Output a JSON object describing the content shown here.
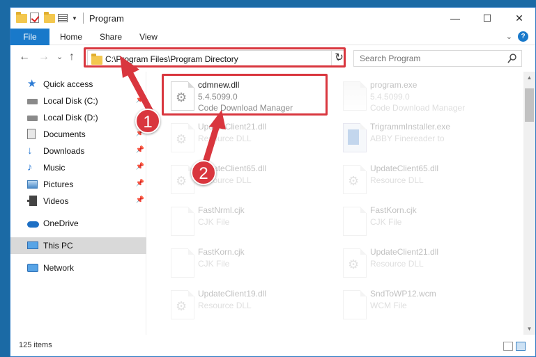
{
  "titlebar": {
    "title": "Program",
    "controls": {
      "minimize": "—",
      "maximize": "☐",
      "close": "✕"
    }
  },
  "ribbon": {
    "tabs": [
      "File",
      "Home",
      "Share",
      "View"
    ],
    "expand_icon": "chevron-down-icon",
    "help_label": "?"
  },
  "navigation": {
    "back": "←",
    "forward": "→",
    "recent": "⌄",
    "up": "↑",
    "address": "C:\\Program Files\\Program Directory",
    "refresh": "↻",
    "search_placeholder": "Search Program"
  },
  "sidebar": {
    "items": [
      {
        "label": "Quick access",
        "icon": "star-icon"
      },
      {
        "label": "Local Disk (C:)",
        "icon": "disk-icon",
        "pinned": true
      },
      {
        "label": "Local Disk (D:)",
        "icon": "disk-icon",
        "pinned": true
      },
      {
        "label": "Documents",
        "icon": "documents-icon",
        "pinned": true
      },
      {
        "label": "Downloads",
        "icon": "downloads-icon",
        "pinned": true
      },
      {
        "label": "Music",
        "icon": "music-icon",
        "pinned": true
      },
      {
        "label": "Pictures",
        "icon": "pictures-icon",
        "pinned": true
      },
      {
        "label": "Videos",
        "icon": "videos-icon",
        "pinned": true
      },
      {
        "label": "OneDrive",
        "icon": "onedrive-icon"
      },
      {
        "label": "This PC",
        "icon": "pc-icon",
        "selected": true
      },
      {
        "label": "Network",
        "icon": "network-icon"
      }
    ]
  },
  "files": [
    {
      "name": "cdmnew.dll",
      "line1": "5.4.5099.0",
      "line2": "Code Download Manager",
      "icon": "dll-file-icon",
      "highlighted": true
    },
    {
      "name": "program.exe",
      "line1": "5.4.5099.0",
      "line2": "Code Download Manager",
      "icon": "exe-file-icon"
    },
    {
      "name": "UpdateClient21.dll",
      "line1": "Resource DLL",
      "line2": "",
      "icon": "dll-file-icon"
    },
    {
      "name": "TrigrammInstaller.exe",
      "line1": "ABBY Finereader to",
      "line2": "",
      "icon": "installer-file-icon"
    },
    {
      "name": "UpdateClient65.dll",
      "line1": "Resource DLL",
      "line2": "",
      "icon": "dll-file-icon"
    },
    {
      "name": "UpdateClient65.dll",
      "line1": "Resource DLL",
      "line2": "",
      "icon": "dll-file-icon"
    },
    {
      "name": "FastNrml.cjk",
      "line1": "CJK File",
      "line2": "",
      "icon": "generic-file-icon"
    },
    {
      "name": "FastKorn.cjk",
      "line1": "CJK File",
      "line2": "",
      "icon": "generic-file-icon"
    },
    {
      "name": "FastKorn.cjk",
      "line1": "CJK File",
      "line2": "",
      "icon": "generic-file-icon"
    },
    {
      "name": "UpdateClient21.dll",
      "line1": "Resource DLL",
      "line2": "",
      "icon": "dll-file-icon"
    },
    {
      "name": "UpdateClient19.dll",
      "line1": "Resource DLL",
      "line2": "",
      "icon": "dll-file-icon"
    },
    {
      "name": "SndToWP12.wcm",
      "line1": "WCM File",
      "line2": "",
      "icon": "generic-file-icon"
    }
  ],
  "status": {
    "item_count": "125 items"
  },
  "annotations": {
    "callout1": "1",
    "callout2": "2",
    "color": "#d9363e"
  }
}
